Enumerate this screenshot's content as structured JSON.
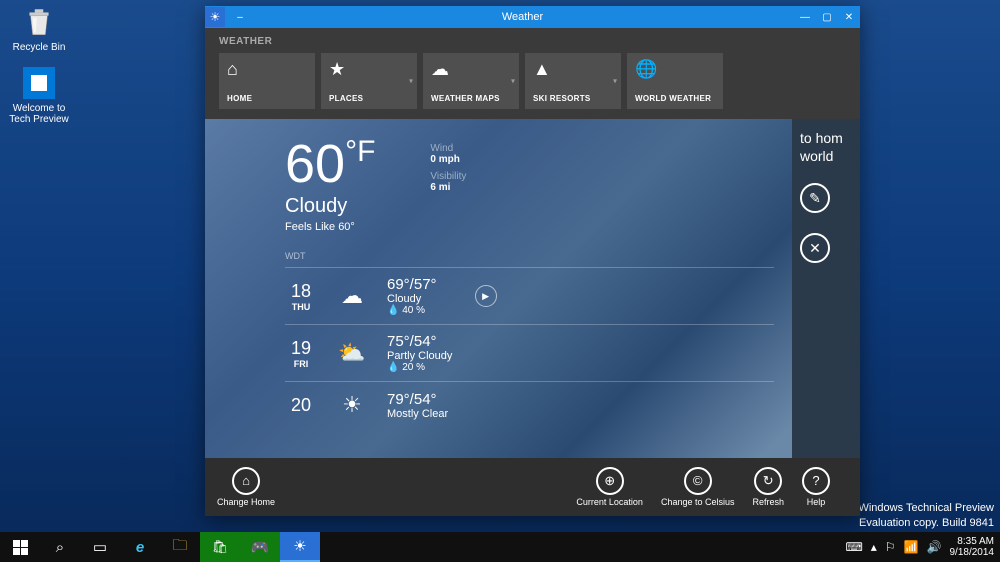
{
  "desktop": {
    "recycle_label": "Recycle Bin",
    "welcome_label": "Welcome to Tech Preview"
  },
  "window": {
    "title": "Weather",
    "nav_header": "WEATHER",
    "nav": [
      {
        "label": "HOME",
        "icon": "home-icon",
        "glyph": "⌂",
        "dropdown": false
      },
      {
        "label": "PLACES",
        "icon": "star-icon",
        "glyph": "★",
        "dropdown": true
      },
      {
        "label": "WEATHER MAPS",
        "icon": "cloud-sun-icon",
        "glyph": "☁",
        "dropdown": true
      },
      {
        "label": "SKI RESORTS",
        "icon": "mountain-icon",
        "glyph": "▲",
        "dropdown": true
      },
      {
        "label": "WORLD WEATHER",
        "icon": "globe-icon",
        "glyph": "🌐",
        "dropdown": false
      }
    ]
  },
  "current": {
    "temp": "60",
    "unit": "°F",
    "condition": "Cloudy",
    "feels": "Feels Like 60°",
    "wind_label": "Wind",
    "wind_val": "0 mph",
    "vis_label": "Visibility",
    "vis_val": "6 mi",
    "provider": "WDT"
  },
  "forecast": [
    {
      "daynum": "18",
      "day": "THU",
      "hilo": "69°/57°",
      "cond": "Cloudy",
      "precip": "40 %",
      "glyph": "☁",
      "play": true
    },
    {
      "daynum": "19",
      "day": "FRI",
      "hilo": "75°/54°",
      "cond": "Partly Cloudy",
      "precip": "20 %",
      "glyph": "⛅",
      "play": false
    },
    {
      "daynum": "20",
      "day": "",
      "hilo": "79°/54°",
      "cond": "Mostly Clear",
      "precip": "",
      "glyph": "☀",
      "play": false
    }
  ],
  "right_panel": {
    "line1": "to hom",
    "line2": "world"
  },
  "bottombar": {
    "change_home": "Change Home",
    "current_loc": "Current Location",
    "change_celsius": "Change to Celsius",
    "refresh": "Refresh",
    "help": "Help"
  },
  "watermark": {
    "line1": "Windows Technical Preview",
    "line2": "Evaluation copy. Build 9841"
  },
  "taskbar": {
    "time": "8:35 AM",
    "date": "9/18/2014"
  }
}
